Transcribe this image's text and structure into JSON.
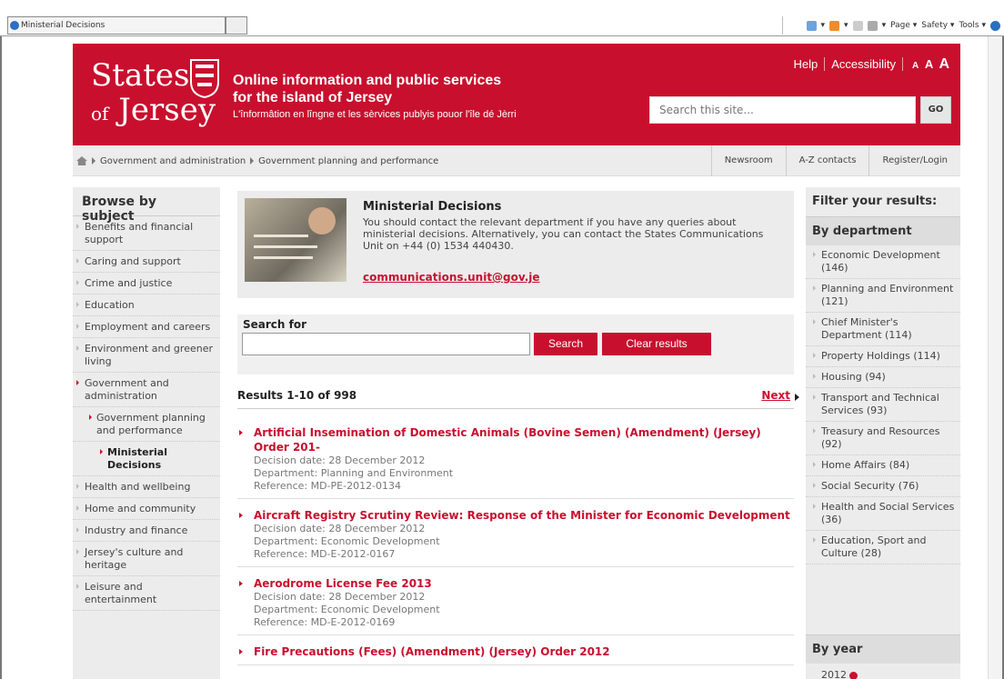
{
  "browser": {
    "tab_title": "Ministerial Decisions",
    "commands": [
      "Page ▾",
      "Safety ▾",
      "Tools ▾"
    ]
  },
  "masthead": {
    "logo_line1": "States",
    "logo_line2_of": "of",
    "logo_line2_name": "Jersey",
    "tagline1": "Online information and public services",
    "tagline2": "for the island of Jersey",
    "tagline3": "L'înformâtion en lîngne et les sèrvices publyis pouor l'île dé Jèrri",
    "help": "Help",
    "accessibility": "Accessibility",
    "text_sizes": [
      "A",
      "A",
      "A"
    ],
    "search_placeholder": "Search this site...",
    "go": "GO"
  },
  "breadcrumb": {
    "items": [
      "Government and administration",
      "Government planning and performance"
    ]
  },
  "quick_links": [
    "Newsroom",
    "A-Z contacts",
    "Register/Login"
  ],
  "left_nav": {
    "heading": "Browse by subject",
    "items": [
      {
        "label": "Benefits and financial support",
        "level": 0
      },
      {
        "label": "Caring and support",
        "level": 0
      },
      {
        "label": "Crime and justice",
        "level": 0
      },
      {
        "label": "Education",
        "level": 0
      },
      {
        "label": "Employment and careers",
        "level": 0
      },
      {
        "label": "Environment and greener living",
        "level": 0
      },
      {
        "label": "Government and administration",
        "level": 0,
        "active": true
      },
      {
        "label": "Government planning and performance",
        "level": 1,
        "active": true
      },
      {
        "label": "Ministerial Decisions",
        "level": 2,
        "active": true
      },
      {
        "label": "Health and wellbeing",
        "level": 0
      },
      {
        "label": "Home and community",
        "level": 0
      },
      {
        "label": "Industry and finance",
        "level": 0
      },
      {
        "label": "Jersey's culture and heritage",
        "level": 0
      },
      {
        "label": "Leisure and entertainment",
        "level": 0
      }
    ]
  },
  "intro": {
    "title": "Ministerial Decisions",
    "body": "You should contact the relevant department if you have any queries about ministerial decisions. Alternatively, you can contact the States Communications Unit on +44 (0) 1534 440430.",
    "email": "communications.unit@gov.je"
  },
  "search": {
    "label": "Search for",
    "value": "",
    "search_button": "Search",
    "clear_button": "Clear results"
  },
  "results_bar": {
    "count": "Results 1-10 of 998",
    "next": "Next"
  },
  "results": [
    {
      "title": "Artificial Insemination of Domestic Animals (Bovine Semen) (Amendment) (Jersey) Order 201-",
      "date": "Decision date: 28 December 2012",
      "department": "Department: Planning and Environment",
      "reference": "Reference: MD-PE-2012-0134"
    },
    {
      "title": "Aircraft Registry Scrutiny Review: Response of the Minister for Economic Development",
      "date": "Decision date: 28 December 2012",
      "department": "Department: Economic Development",
      "reference": "Reference: MD-E-2012-0167"
    },
    {
      "title": "Aerodrome License Fee 2013",
      "date": "Decision date: 28 December 2012",
      "department": "Department: Economic Development",
      "reference": "Reference: MD-E-2012-0169"
    },
    {
      "title": "Fire Precautions (Fees) (Amendment) (Jersey) Order 2012",
      "date": "",
      "department": "",
      "reference": ""
    }
  ],
  "filters": {
    "heading": "Filter your results:",
    "by_department": "By department",
    "departments": [
      "Economic Development (146)",
      "Planning and Environment (121)",
      "Chief Minister's Department (114)",
      "Property Holdings (114)",
      "Housing (94)",
      "Transport and Technical Services (93)",
      "Treasury and Resources (92)",
      "Home Affairs (84)",
      "Social Security (76)",
      "Health and Social Services (36)",
      "Education, Sport and Culture (28)"
    ],
    "by_year": "By year",
    "years": [
      "2012"
    ]
  },
  "colors": {
    "brand_red": "#c8102e",
    "panel_grey": "#ececec"
  }
}
